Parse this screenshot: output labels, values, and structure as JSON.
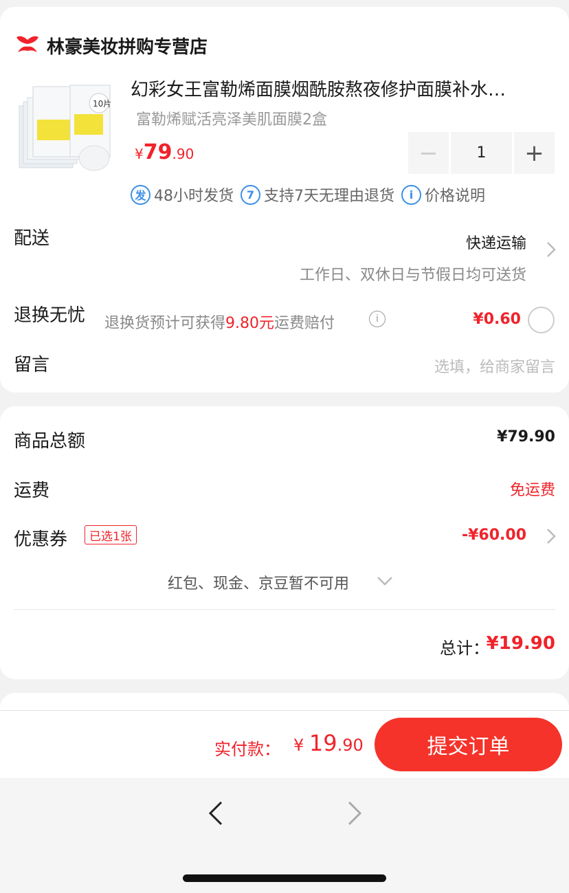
{
  "store": {
    "logo_icon": "store-logo-icon",
    "name": "林豪美妆拼购专营店"
  },
  "product": {
    "image_badge": "10片",
    "title": "幻彩女王富勒烯面膜烟酰胺熬夜修护面膜补水…",
    "spec": "富勒烯赋活亮泽美肌面膜2盒",
    "price_symbol": "¥",
    "price_int": "79",
    "price_dec": ".90",
    "quantity": "1",
    "minus_label": "−",
    "plus_label": "+",
    "tags": [
      {
        "icon": "发",
        "label": "48小时发货"
      },
      {
        "icon": "7",
        "label": "支持7天无理由退货"
      },
      {
        "icon": "i",
        "label": "价格说明"
      }
    ]
  },
  "delivery": {
    "label": "配送",
    "method": "快递运输",
    "note": "工作日、双休日与节假日均可送货"
  },
  "return_insurance": {
    "label": "退换无忧",
    "desc_prefix": "退换货预计可获得",
    "desc_amount": "9.80元",
    "desc_suffix": "运费赔付",
    "info_icon": "i",
    "price": "¥0.60"
  },
  "message": {
    "label": "留言",
    "placeholder": "选填，给商家留言"
  },
  "summary": {
    "goods_label": "商品总额",
    "goods_value": "¥79.90",
    "shipping_label": "运费",
    "shipping_value": "免运费",
    "coupon_label": "优惠券",
    "coupon_badge": "已选1张",
    "coupon_value": "-¥60.00",
    "unavailable_text": "红包、现金、京豆暂不可用",
    "total_label": "总计：",
    "total_value": "¥19.90"
  },
  "checkout": {
    "pay_label": "实付款：",
    "pay_symbol": "¥ ",
    "pay_int": "19",
    "pay_dec": ".90",
    "submit_label": "提交订单"
  },
  "colors": {
    "accent": "#f0232b",
    "button": "#f5332a",
    "tag_blue": "#3b8fe6"
  }
}
